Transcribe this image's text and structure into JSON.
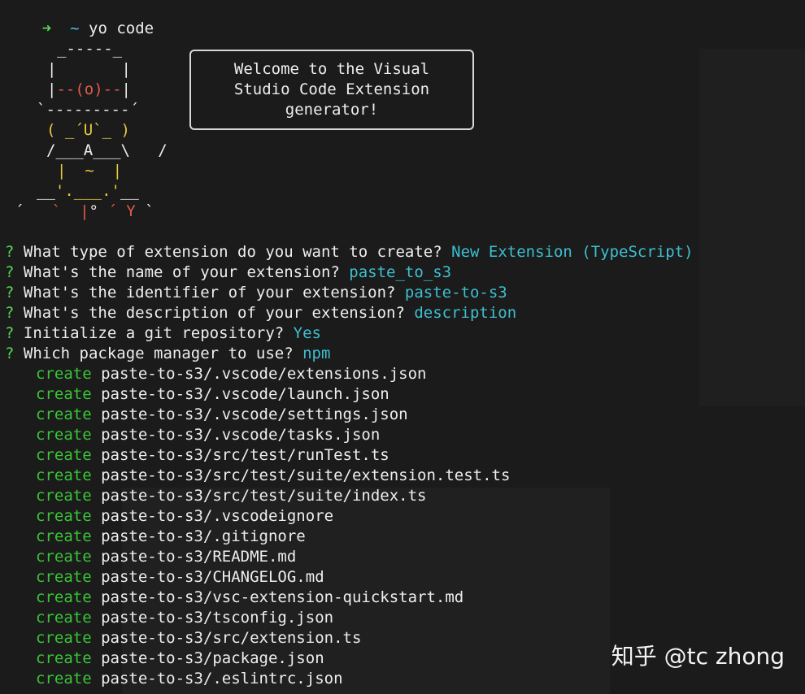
{
  "command": {
    "arrow": "➜",
    "tilde": "~",
    "text": "yo code"
  },
  "welcome": {
    "line1": "Welcome to the Visual",
    "line2": "Studio Code Extension",
    "line3": "generator!"
  },
  "questions": [
    {
      "mark": "?",
      "text": "What type of extension do you want to create?",
      "answer": "New Extension (TypeScript)"
    },
    {
      "mark": "?",
      "text": "What's the name of your extension?",
      "answer": "paste_to_s3"
    },
    {
      "mark": "?",
      "text": "What's the identifier of your extension?",
      "answer": "paste-to-s3"
    },
    {
      "mark": "?",
      "text": "What's the description of your extension?",
      "answer": "description"
    },
    {
      "mark": "?",
      "text": "Initialize a git repository?",
      "answer": "Yes"
    },
    {
      "mark": "?",
      "text": "Which package manager to use?",
      "answer": "npm"
    }
  ],
  "create_label": "create",
  "files": [
    "paste-to-s3/.vscode/extensions.json",
    "paste-to-s3/.vscode/launch.json",
    "paste-to-s3/.vscode/settings.json",
    "paste-to-s3/.vscode/tasks.json",
    "paste-to-s3/src/test/runTest.ts",
    "paste-to-s3/src/test/suite/extension.test.ts",
    "paste-to-s3/src/test/suite/index.ts",
    "paste-to-s3/.vscodeignore",
    "paste-to-s3/.gitignore",
    "paste-to-s3/README.md",
    "paste-to-s3/CHANGELOG.md",
    "paste-to-s3/vsc-extension-quickstart.md",
    "paste-to-s3/tsconfig.json",
    "paste-to-s3/src/extension.ts",
    "paste-to-s3/package.json",
    "paste-to-s3/.eslintrc.json"
  ],
  "watermark": "知乎 @tc zhong",
  "colors": {
    "background": "#1b1b1b",
    "prompt_green": "#55d655",
    "answer_cyan": "#3dbfcf",
    "create_green": "#39c536",
    "ascii_red": "#e05a4a",
    "ascii_yellow": "#e8c93a"
  }
}
